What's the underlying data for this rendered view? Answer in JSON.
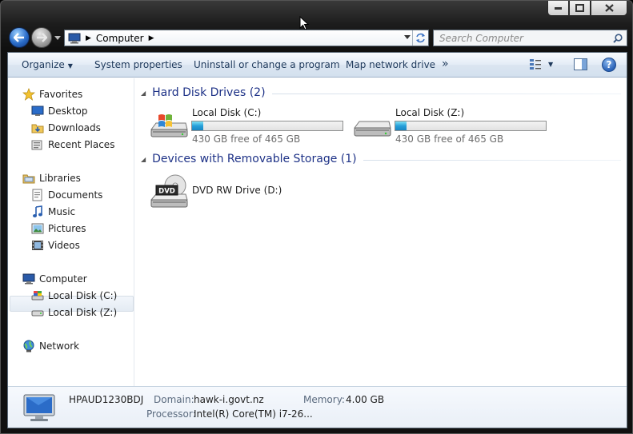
{
  "window": {
    "caption_buttons": [
      "minimize-icon",
      "maximize-icon",
      "close-icon"
    ]
  },
  "navigation": {
    "address_breadcrumb": "Computer",
    "search_placeholder": "Search Computer"
  },
  "toolbar": {
    "organize": "Organize",
    "system_properties": "System properties",
    "uninstall": "Uninstall or change a program",
    "map_network_drive": "Map network drive",
    "more": "»"
  },
  "sidebar": {
    "favorites": {
      "label": "Favorites",
      "items": [
        "Desktop",
        "Downloads",
        "Recent Places"
      ]
    },
    "libraries": {
      "label": "Libraries",
      "items": [
        "Documents",
        "Music",
        "Pictures",
        "Videos"
      ]
    },
    "computer": {
      "label": "Computer",
      "items": [
        "Local Disk (C:)",
        "Local Disk (Z:)"
      ]
    },
    "network": {
      "label": "Network"
    }
  },
  "content": {
    "hard_disk_group": "Hard Disk Drives (2)",
    "removable_group": "Devices with Removable Storage (1)",
    "drives": [
      {
        "name": "Local Disk (C:)",
        "free_text": "430 GB free of 465 GB",
        "used_fraction": 0.075
      },
      {
        "name": "Local Disk (Z:)",
        "free_text": "430 GB free of 465 GB",
        "used_fraction": 0.075
      }
    ],
    "dvd": {
      "name": "DVD RW Drive (D:)",
      "icon_label": "DVD"
    }
  },
  "details": {
    "computer_name": "HPAUD1230BDJ",
    "domain_label": "Domain:",
    "domain_value": "hawk-i.govt.nz",
    "memory_label": "Memory:",
    "memory_value": "4.00 GB",
    "processor_label": "Processor:",
    "processor_value": "Intel(R) Core(TM) i7-26..."
  },
  "colors": {
    "group_title": "#1e3287",
    "toolbar_text": "#1e395b",
    "bar_fill": "#26a0da"
  }
}
